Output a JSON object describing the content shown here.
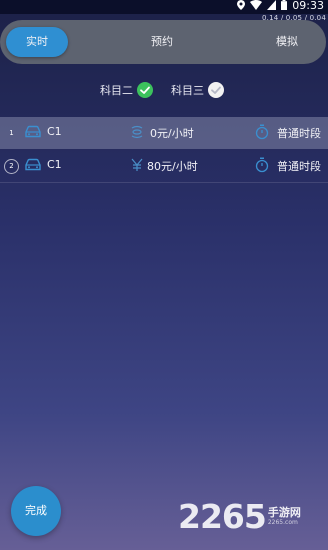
{
  "status_bar": {
    "time": "09:33",
    "net_rate": "0.14 / 0.05 / 0.04",
    "icons": [
      "location-icon",
      "wifi-icon",
      "signal-icon",
      "battery-icon"
    ]
  },
  "tabs": [
    {
      "label": "实时",
      "active": true
    },
    {
      "label": "预约",
      "active": false
    },
    {
      "label": "模拟",
      "active": false
    }
  ],
  "subjects": [
    {
      "label": "科目二",
      "checked": true,
      "check_color": "#3cc25d"
    },
    {
      "label": "科目三",
      "checked": true,
      "check_color": "#f2f2f2"
    }
  ],
  "rows": [
    {
      "index": "1",
      "plate": "C1",
      "price": "0元/小时",
      "period": "普通时段",
      "highlighted": true
    },
    {
      "index": "2",
      "plate": "C1",
      "price": "80元/小时",
      "period": "普通时段",
      "highlighted": false
    }
  ],
  "done_button": {
    "label": "完成"
  },
  "watermark": {
    "number": "2265",
    "cn": "手游网",
    "url": "2265.com"
  },
  "colors": {
    "accent": "#2f8fd2",
    "tab_bar": "#5d6370",
    "check_green": "#3cc25d"
  }
}
